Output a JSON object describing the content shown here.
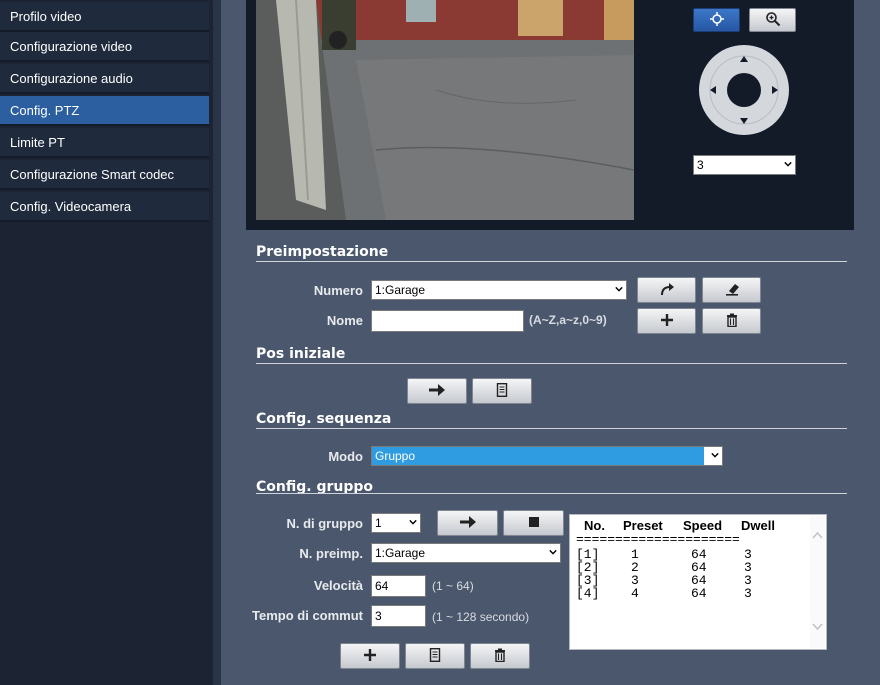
{
  "sidebar": {
    "items": [
      {
        "label": "Profilo video"
      },
      {
        "label": "Configurazione video"
      },
      {
        "label": "Configurazione audio"
      },
      {
        "label": "Config. PTZ"
      },
      {
        "label": "Limite PT"
      },
      {
        "label": "Configurazione Smart codec"
      },
      {
        "label": "Config. Videocamera"
      }
    ]
  },
  "ptz": {
    "speed_value": "3"
  },
  "preset": {
    "title": "Preimpostazione",
    "numero_label": "Numero",
    "numero_value": "1:Garage",
    "nome_label": "Nome",
    "nome_value": "",
    "nome_hint": "(A~Z,a~z,0~9)"
  },
  "home": {
    "title": "Pos iniziale"
  },
  "sequence": {
    "title": "Config. sequenza",
    "modo_label": "Modo",
    "modo_value": "Gruppo"
  },
  "group": {
    "title": "Config. gruppo",
    "n_gruppo_label": "N. di gruppo",
    "n_gruppo_value": "1",
    "n_preimp_label": "N. preimp.",
    "n_preimp_value": "1:Garage",
    "velocita_label": "Velocità",
    "velocita_value": "64",
    "velocita_hint": "(1 ~ 64)",
    "tempo_label": "Tempo di commut",
    "tempo_value": "3",
    "tempo_hint": "(1 ~ 128 secondo)"
  },
  "table": {
    "headers": [
      "No.",
      "Preset",
      "Speed",
      "Dwell"
    ],
    "separator": "=====================",
    "rows": [
      [
        "[1]",
        "1",
        "64",
        "3"
      ],
      [
        "[2]",
        "2",
        "64",
        "3"
      ],
      [
        "[3]",
        "3",
        "64",
        "3"
      ],
      [
        "[4]",
        "4",
        "64",
        "3"
      ]
    ]
  },
  "icons": {
    "move": "move-crosshair-icon",
    "zoom": "zoom-in-icon",
    "goto": "goto-arrow-icon",
    "clear": "eraser-icon",
    "add": "plus-icon",
    "delete": "trash-icon",
    "go": "right-arrow-icon",
    "save": "document-icon",
    "stop": "stop-icon"
  }
}
